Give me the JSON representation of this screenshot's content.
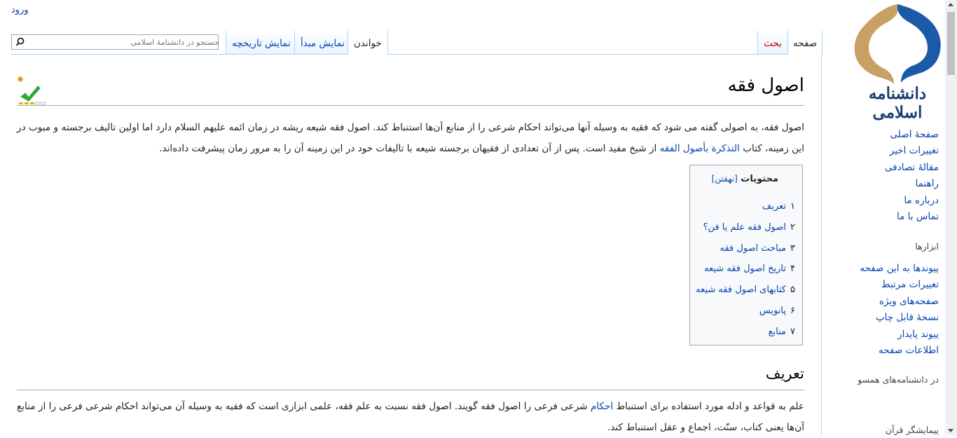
{
  "login": {
    "label": "ورود"
  },
  "logo": {
    "text": "دانشنامه اسلامی"
  },
  "sidebar": {
    "main": [
      "صفحهٔ اصلی",
      "تغییرات اخیر",
      "مقالهٔ تصادفی",
      "راهنما",
      "درباره ما",
      "تماس با ما"
    ],
    "tools_heading": "ابزارها",
    "tools": [
      "پیوندها به این صفحه",
      "تغییرات مرتبط",
      "صفحه‌های ویژه",
      "نسخهٔ قابل چاپ",
      "پیوند پایدار",
      "اطلاعات صفحه"
    ],
    "sister_heading": "در دانشنامه‌های همسو",
    "quran": "پیمایشگر قرآن"
  },
  "tabs": {
    "page": "صفحه",
    "talk": "بحث",
    "read": "خواندن",
    "view_source": "نمایش مبدأ",
    "history": "نمایش تاریخچه"
  },
  "search": {
    "placeholder": "جستجو در دانشنامهٔ اسلامی"
  },
  "article": {
    "title": "اصول فقه",
    "intro_before_link": "اصول فقه، به اصولی گفته می شود که فقیه به وسیله آنها می‌تواند احکام شرعی را از منابع آن‌ها استنباط کند. اصول فقه شیعه ریشه در زمان ائمه علیهم السلام دارد اما اولین تالیف برجسته و مبوب در این زمینه، کتاب ",
    "intro_link": "التذکرة بأصول الفقه",
    "intro_after_link": " از شیخ مفید است. پس از آن تعدادی از فقیهان برجسته شیعه با تالیفات خود در این زمینه آن را به مرور زمان پیشرفت داده‌اند.",
    "toc": {
      "title": "محتویات",
      "toggle": "[نهفتن]",
      "items": [
        {
          "num": "۱",
          "label": "تعریف"
        },
        {
          "num": "۲",
          "label": "اصول فقه علم یا فن؟"
        },
        {
          "num": "۳",
          "label": "مباحث اصول فقه"
        },
        {
          "num": "۴",
          "label": "تاریخ اصول فقه شیعه"
        },
        {
          "num": "۵",
          "label": "کتابهای اصول فقه شیعه"
        },
        {
          "num": "۶",
          "label": "پانویس"
        },
        {
          "num": "۷",
          "label": "منابع"
        }
      ]
    },
    "section1_title": "تعریف",
    "section1_before_link": "علم به قواعد و ادله مورد استفاده برای استنباط ",
    "section1_link": "احکام",
    "section1_after_link": " شرعی فرعی را اصول فقه گویند. اصول فقه نسبت به علم فقه، علمی ابزاری است که فقیه به وسیله آن می‌تواند احکام شرعی فرعی را از منابع آن‌ها یعنی کتاب، سنّت، اجماع و عقل استنباط کند."
  },
  "colors": {
    "link": "#0645ad",
    "new_link": "#ba0000",
    "border": "#a7d7f9",
    "logo_gold": "#c9a063",
    "logo_blue": "#1b5aa6"
  }
}
